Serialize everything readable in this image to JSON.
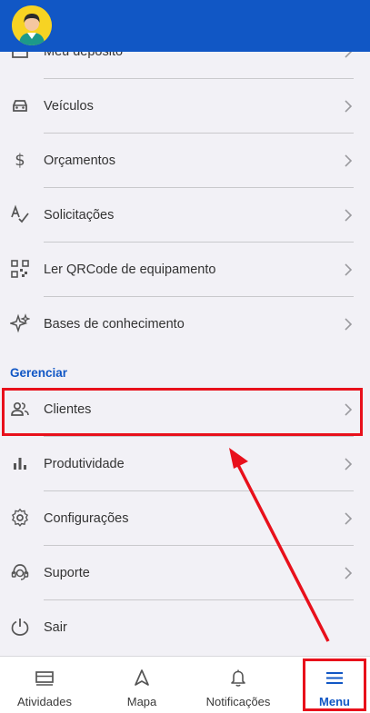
{
  "menu": {
    "items_top": [
      {
        "label": "Meu depósito",
        "icon": "warehouse-icon"
      },
      {
        "label": "Veículos",
        "icon": "car-icon"
      },
      {
        "label": "Orçamentos",
        "icon": "dollar-icon"
      },
      {
        "label": "Solicitações",
        "icon": "spellcheck-icon"
      },
      {
        "label": "Ler QRCode de equipamento",
        "icon": "qrcode-icon"
      },
      {
        "label": "Bases de conhecimento",
        "icon": "sparkles-icon"
      }
    ],
    "section_title": "Gerenciar",
    "items_manage": [
      {
        "label": "Clientes",
        "icon": "people-icon"
      },
      {
        "label": "Produtividade",
        "icon": "bar-chart-icon"
      },
      {
        "label": "Configurações",
        "icon": "gear-icon"
      },
      {
        "label": "Suporte",
        "icon": "support-agent-icon"
      },
      {
        "label": "Sair",
        "icon": "power-icon"
      }
    ]
  },
  "tabs": [
    {
      "label": "Atividades",
      "icon": "activities-icon"
    },
    {
      "label": "Mapa",
      "icon": "navigation-arrow-icon"
    },
    {
      "label": "Notificações",
      "icon": "bell-icon"
    },
    {
      "label": "Menu",
      "icon": "hamburger-menu-icon",
      "active": true
    }
  ],
  "colors": {
    "brand_blue": "#1157c5",
    "highlight_red": "#e8101b",
    "background": "#f2f1f6"
  }
}
